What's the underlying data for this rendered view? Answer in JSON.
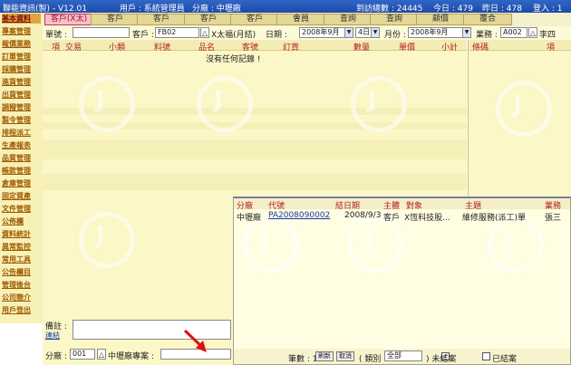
{
  "titlebar": {
    "app": "聯能資訊(製) - V12.01",
    "user": "用戶 : 系統管理員",
    "dept": "分廠 : 中壢廠",
    "visits": "到訪總數 : 24445",
    "today": "今日 : 479",
    "yesterday": "昨日 : 478",
    "login": "登入 : 1"
  },
  "tabs": [
    "客戶(X太)",
    "客戶",
    "客戶",
    "客戶",
    "客戶",
    "會員",
    "查詢",
    "查詢",
    "顧價",
    "覆合"
  ],
  "sidebar": [
    "基本資料",
    "專案管理",
    "報價業務",
    "訂單管理",
    "採購管理",
    "進貨管理",
    "出貨管理",
    "調撥管理",
    "製令管理",
    "排程派工",
    "生產報表",
    "品質管理",
    "帳款管理",
    "倉庫管理",
    "固定資產",
    "文件管理",
    "公佈欄",
    "資料統計",
    "異常監控",
    "常用工具",
    "公告欄目",
    "管理後台",
    "公司簡介",
    "用戶登出"
  ],
  "filters": {
    "single_label": "單號 :",
    "customer_label": "客戶 :",
    "customer_code": "FB02",
    "customer_name": "X太福(月結)",
    "date_label": "日期 :",
    "year_value": "2008年9月",
    "month_value": "4日",
    "period_label": "月份 :",
    "period_value": "2008年9月",
    "sales_label": "業務 :",
    "sales_code": "A002",
    "sales_name": "李四"
  },
  "grid": {
    "headers": [
      "項",
      "交易",
      "小類",
      "料號",
      "品名",
      "客號",
      "訂貨",
      "數量",
      "單價",
      "小計"
    ],
    "empty_message": "沒有任何記錄 !",
    "right_headers": [
      "條碼",
      "項"
    ]
  },
  "popup": {
    "headers": [
      "分廠",
      "代號",
      "結日期",
      "主體",
      "對象",
      "主題",
      "業務"
    ],
    "row": {
      "branch": "中壢廠",
      "code": "PA2008090002",
      "date": "2008/9/3",
      "subject": "客戶",
      "target": "X恆科技股...",
      "topic": "維修服務(派工)單",
      "sales": "張三"
    },
    "footer": {
      "count": "筆數 : 1",
      "refresh": "刷新",
      "cancel": "取消",
      "type_label": "( 類別",
      "type_value": "全部",
      "open_label": ") 未結案",
      "closed_label": "已結案"
    }
  },
  "bottom": {
    "note_label": "備註 :",
    "note_link": "連結",
    "branch_label": "分廠 :",
    "branch_code": "001",
    "branch_project": "中壢廠專案 :"
  }
}
